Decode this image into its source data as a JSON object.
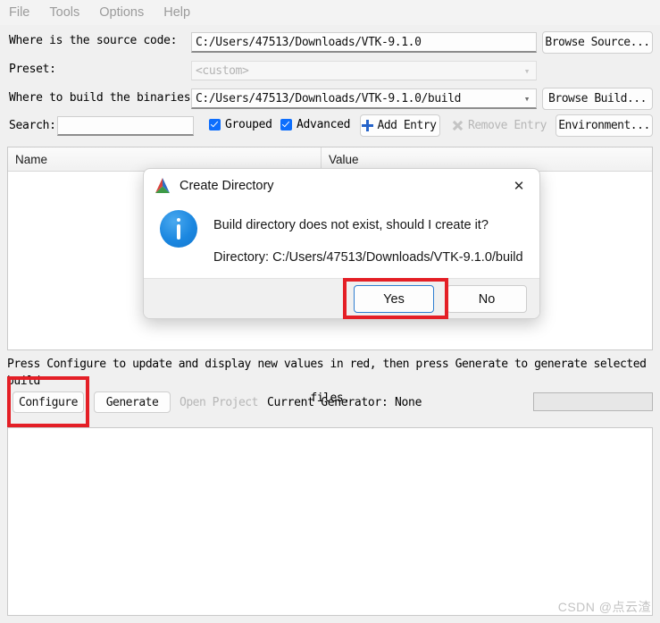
{
  "menubar": {
    "items": [
      {
        "label": "File",
        "name": "menu-file"
      },
      {
        "label": "Tools",
        "name": "menu-tools"
      },
      {
        "label": "Options",
        "name": "menu-options"
      },
      {
        "label": "Help",
        "name": "menu-help"
      }
    ]
  },
  "form": {
    "source_label": "Where is the source code:",
    "source_value": "C:/Users/47513/Downloads/VTK-9.1.0",
    "browse_source_label": "Browse Source...",
    "preset_label": "Preset:",
    "preset_value": "<custom>",
    "build_label": "Where to build the binaries:",
    "build_value": "C:/Users/47513/Downloads/VTK-9.1.0/build",
    "browse_build_label": "Browse Build...",
    "search_label": "Search:",
    "search_value": "",
    "search_placeholder": "",
    "grouped_label": "Grouped",
    "advanced_label": "Advanced",
    "add_entry_label": "Add Entry",
    "remove_entry_label": "Remove Entry",
    "environment_label": "Environment..."
  },
  "cache_table": {
    "columns": [
      "Name",
      "Value"
    ],
    "rows": []
  },
  "status": {
    "line1": "Press Configure to update and display new values in red, then press Generate to generate selected build",
    "line2": "files.",
    "configure_label": "Configure",
    "generate_label": "Generate",
    "open_project_label": "Open Project",
    "current_generator_label": "Current Generator: None",
    "progress_value": ""
  },
  "dialog": {
    "title": "Create Directory",
    "close_label": "✕",
    "message": "Build directory does not exist, should I create it?",
    "directory_line": "Directory: C:/Users/47513/Downloads/VTK-9.1.0/build",
    "yes_label": "Yes",
    "no_label": "No"
  },
  "watermark": {
    "text": "CSDN @点云渣"
  },
  "colors": {
    "accent_blue": "#0d6efd",
    "annotation_red": "#e41f26",
    "info_blue": "#1b87e0"
  }
}
